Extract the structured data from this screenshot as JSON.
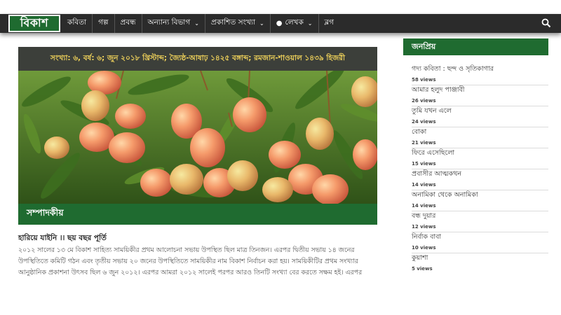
{
  "brand": {
    "logo_text": "বিকাশ"
  },
  "nav": {
    "items": [
      {
        "label": "কবিতা"
      },
      {
        "label": "গল্প"
      },
      {
        "label": "প্রবন্ধ"
      },
      {
        "label": "অন্যান্য বিভাগ"
      },
      {
        "label": "প্রকাশিত সংখ্যা"
      },
      {
        "label": "লেখক"
      },
      {
        "label": "ব্লগ"
      }
    ]
  },
  "feature": {
    "issue_info": "সংখ্যা: ৬, বর্ষ: ৬; জুন ২০১৮ খ্রিস্টাব্দ; জ্যৈষ্ঠ-আষাঢ় ১৪২৫ বঙ্গাব্দ; রমজান-শাওয়াল ১৪৩৯ হিজরী",
    "caption": "সম্পাদকীয়"
  },
  "article": {
    "title": "হারিয়ে যাইনি ।। ছয় বছর পূর্তি",
    "lines": [
      "২০১২ সালের ১৩ মে বিকাশ সাহিত্য সাময়িকীর প্রথম আলোচনা সভায় উপস্থিত ছিল মাত্র তিনজন। এরপর দ্বিতীয় সভায় ১৪ জনের",
      "উপস্থিতিতে কমিটি গঠন এবং তৃতীয় সভায় ২০ জনের উপস্থিতিতে সাময়িকীর নাম বিকাশ নির্বাচন করা হয়। সাময়িকীটির প্রথম সংখ্যার",
      "আনুষ্ঠানিক প্রকাশনা উৎসব ছিল ৬ জুন ২০১২। এরপর আমরা ২০১২ সালেই পরপর আরও তিনটি সংখ্যা বের করতে সক্ষম হই। এরপর"
    ]
  },
  "sidebar": {
    "heading": "জনপ্রিয়",
    "items": [
      {
        "title": "গদ্য কবিতা : ছন্দ ও সৃতিকাগার",
        "views": "58 views"
      },
      {
        "title": "আমার হলুদ পাঞ্জাবী",
        "views": "26 views"
      },
      {
        "title": "তুমি যখন এলে",
        "views": "24 views"
      },
      {
        "title": "বোকা",
        "views": "21 views"
      },
      {
        "title": "ফিরে এসেছিলো",
        "views": "15 views"
      },
      {
        "title": "প্রবাসীর আত্মকথন",
        "views": "14 views"
      },
      {
        "title": "অনামিকা থেকে অনামিকা",
        "views": "14 views"
      },
      {
        "title": "বন্ধ দুয়ার",
        "views": "12 views"
      },
      {
        "title": "নির্বাক বাবা",
        "views": "10 views"
      },
      {
        "title": "কুয়াশা",
        "views": "5 views"
      }
    ]
  },
  "colors": {
    "brand_green": "#1f6b30",
    "navbar": "#2b2b2b",
    "issue_text": "#f0d25a"
  },
  "icons": {
    "search": "search-icon",
    "user": "user-icon",
    "dropdown": "chevron-down-icon"
  }
}
